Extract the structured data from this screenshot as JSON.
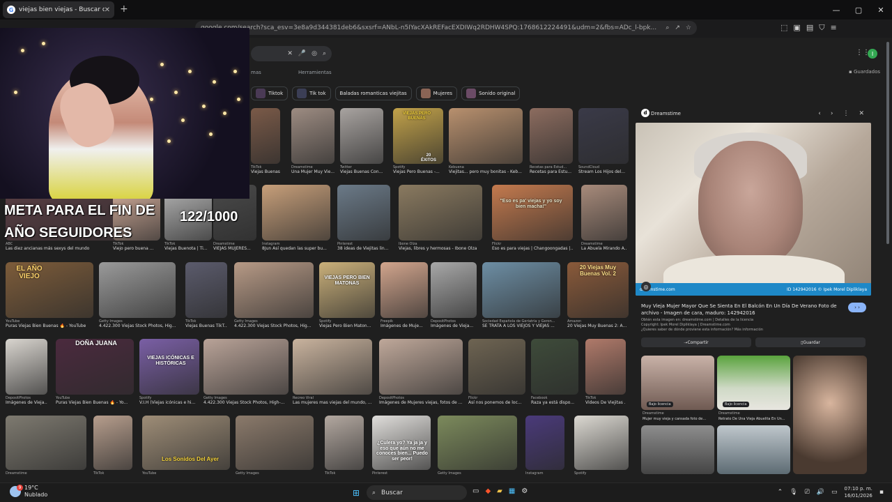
{
  "browser": {
    "tab_title": "viejas bien viejas - Buscar con Google",
    "tab_close": "✕",
    "new_tab": "+",
    "url": "google.com/search?sca_esv=3e8a9d344381deb6&sxsrf=ANbL-n5IYacXAkREFacEXDIWq2RDHW4SPQ:1768612224491&udm=2&fbs=ADc_l-bpk...",
    "minimize": "—",
    "maximize": "▢",
    "close": "✕"
  },
  "google": {
    "nav_images_label": "mas",
    "nav_tools": "Herramientas",
    "saved": "Guardados",
    "avatar_initial": "I",
    "chips": [
      "Tiktok",
      "Tik tok",
      "Baladas romanticas viejitas",
      "Mujeres",
      "Sonido original"
    ]
  },
  "results": [
    {
      "src": "TikTok",
      "cap": "Viejas Buenas | Vie..."
    },
    {
      "src": "Dreamstime",
      "cap": "Una Mujer Muy Vie..."
    },
    {
      "src": "Twitter",
      "cap": "Viejas Buenas Con..."
    },
    {
      "src": "Spotify",
      "cap": "Viejas Pero Buenas -..."
    },
    {
      "src": "Kebuena",
      "cap": "Viejitas... pero muy bonitas - Keb..."
    },
    {
      "src": "Recetas para Estud...",
      "cap": "Recetas para Estu..."
    },
    {
      "src": "SoundCloud",
      "cap": "Stream Los Hijos del..."
    },
    {
      "src": "ABC",
      "cap": "Las diez ancianas más sexys del mundo"
    },
    {
      "src": "TikTok",
      "cap": "Viejo pero buena ..."
    },
    {
      "src": "TikTok",
      "cap": "Viejas Buenota | Ti..."
    },
    {
      "src": "Dreamstime",
      "cap": "VIEJAS MUJERES..."
    },
    {
      "src": "Instagram",
      "cap": "8Jun Así quedan las super bu..."
    },
    {
      "src": "Pinterest",
      "cap": "38 ideas de Viejitas lin..."
    },
    {
      "src": "Ibone Olza",
      "cap": "Viejas, libres y hermosas - Ibone Olza"
    },
    {
      "src": "Flickr",
      "cap": "Eso es para viejas | Changoongadas |..."
    },
    {
      "src": "Dreamstime",
      "cap": "La Abuela Mirando A..."
    },
    {
      "src": "YouTube",
      "cap": "Puras Viejas Bien Buenas 🔥 - YouTube"
    },
    {
      "src": "Getty Images",
      "cap": "4.422.300 Viejas Stock Photos, Hig..."
    },
    {
      "src": "TikTok",
      "cap": "Viejas Buenas TikT..."
    },
    {
      "src": "Getty Images",
      "cap": "4.422.300 Viejas Stock Photos, Hig..."
    },
    {
      "src": "Spotify",
      "cap": "Viejas Pero Bien Maton..."
    },
    {
      "src": "Freepik",
      "cap": "Imágenes de Muje..."
    },
    {
      "src": "DepositPhotos",
      "cap": "Imágenes de Vieja..."
    },
    {
      "src": "Sociedad Española de Geriatría y Geron...",
      "cap": "SE TRATA A LOS VIEJOS Y VIEJAS ..."
    },
    {
      "src": "Amazon",
      "cap": "20 Viejas Muy Buenas 2: A..."
    },
    {
      "src": "DepositPhotos",
      "cap": "Imágenes de Vieja..."
    },
    {
      "src": "YouTube",
      "cap": "Puras Viejas Bien Buenas 🔥 - Yo..."
    },
    {
      "src": "Spotify",
      "cap": "V.I.H (Viejas icónicas e hi..."
    },
    {
      "src": "Getty Images",
      "cap": "4.422.300 Viejas Stock Photos, High-..."
    },
    {
      "src": "Recreo Viral",
      "cap": "Las mujeres mas viejas del mundo, ..."
    },
    {
      "src": "DepositPhotos",
      "cap": "Imágenes de Mujeres viejas, fotos de ..."
    },
    {
      "src": "Flickr",
      "cap": "Así nos ponemos de loc..."
    },
    {
      "src": "Facebook",
      "cap": "Raza ya está dispo..."
    },
    {
      "src": "TikTok",
      "cap": "Videos De Viejitas ..."
    },
    {
      "src": "Dreamstime",
      "cap": ""
    },
    {
      "src": "TikTok",
      "cap": ""
    },
    {
      "src": "YouTube",
      "cap": ""
    },
    {
      "src": "Getty Images",
      "cap": ""
    },
    {
      "src": "TikTok",
      "cap": ""
    },
    {
      "src": "Pinterest",
      "cap": ""
    },
    {
      "src": "Getty Images",
      "cap": ""
    },
    {
      "src": "Instagram",
      "cap": ""
    },
    {
      "src": "Spotify",
      "cap": ""
    }
  ],
  "image_text": {
    "viejas_buenas": "VIEJAS PERO BUENAS",
    "exitos": "20 ÉXITOS",
    "eso_es": "\"Eso es pa' viejas y yo soy bien macha!\"",
    "el_ano_viejo": "EL AÑO VIEJO",
    "viejas_matonas": "VIEJAS PERO BIEN MATONAS",
    "viejas_20": "20 Viejas Muy Buenas Vol. 2",
    "dona_juana": "DOÑA JUANA",
    "iconicas": "VIEJAS ICÓNICAS E HISTÓRICAS",
    "sonidos": "Los Sonidos Del Ayer",
    "culera": "¿Culera yo? Ya ja ja y eso que aún no me conoces bien... Puedo ser peor!"
  },
  "panel": {
    "source": "Dreamstime",
    "band_left": "dreamstime.com",
    "band_right": "ID 142942016 © Ipek Morel Dipliklaya",
    "title": "Muy Vieja Mujer Mayor Que Se Sienta En El Balcón En Un Día De Verano Foto de archivo - Imagen de cara, maduro: 142942016",
    "meta1": "Obtén esta imagen en: dreamstime.com | Detalles de la licencia",
    "meta2": "Copyright: Ipek Morel Dipliklaya | Dreamstime.com",
    "meta3": "¿Quieres saber de dónde proviene esta información? Más información",
    "visit": "› ›",
    "share": "Compartir",
    "save": "Guardar",
    "related": [
      {
        "src": "Dreamstime",
        "cap": "Mujer muy vieja y cansada foto de..."
      },
      {
        "src": "Dreamstime",
        "cap": "Retrato De Una Vieja Abuelita En Un..."
      }
    ],
    "license_badge": "Bajo licencia"
  },
  "overlay": {
    "goal_line1": "META PARA EL FIN DE",
    "goal_line2": "AÑO SEGUIDORES",
    "counter": "122/1000"
  },
  "taskbar": {
    "temp": "19°C",
    "condition": "Nublado",
    "badge": "9",
    "search": "Buscar",
    "time": "07:10 p. m.",
    "date": "16/01/2026"
  }
}
